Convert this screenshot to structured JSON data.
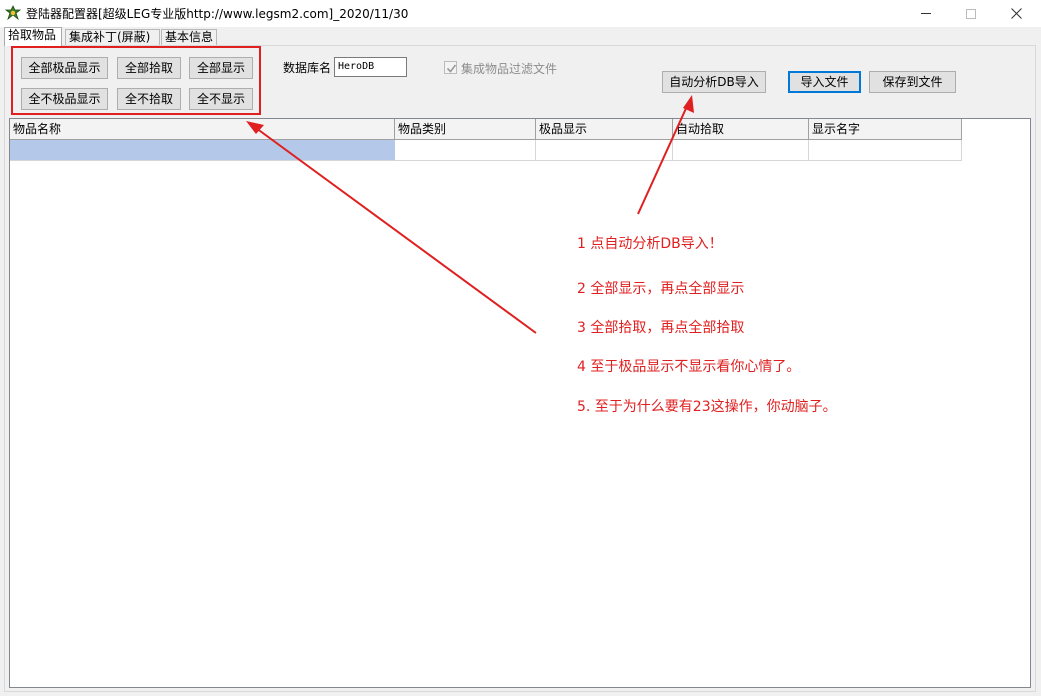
{
  "window": {
    "title": "登陆器配置器[超级LEG专业版http://www.legsm2.com]_2020/11/30",
    "minimize_glyph": "—",
    "maximize_glyph": "☐",
    "close_glyph": "✕"
  },
  "tabs": [
    {
      "label": "拾取物品",
      "active": true
    },
    {
      "label": "集成补丁(屏蔽)",
      "active": false
    },
    {
      "label": "基本信息",
      "active": false
    }
  ],
  "buttons": {
    "all_jipin_show": "全部极品显示",
    "all_pickup": "全部拾取",
    "all_show": "全部显示",
    "none_jipin_show": "全不极品显示",
    "none_pickup": "全不拾取",
    "none_show": "全不显示",
    "auto_import_db": "自动分析DB导入",
    "import_file": "导入文件",
    "save_to_file": "保存到文件"
  },
  "database": {
    "label": "数据库名",
    "value": "HeroDB"
  },
  "filter_checkbox": {
    "label": "集成物品过滤文件",
    "checked": true,
    "enabled": false
  },
  "grid": {
    "columns": [
      "物品名称",
      "物品类别",
      "极品显示",
      "自动拾取",
      "显示名字"
    ],
    "rows": [
      [
        "",
        "",
        "",
        "",
        ""
      ]
    ]
  },
  "annotations": [
    "1 点自动分析DB导入！",
    "2 全部显示，再点全部显示",
    "3 全部拾取，再点全部拾取",
    "4 至于极品显示不显示看你心情了。",
    "5. 至于为什么要有23这操作，你动脑子。"
  ],
  "colors": {
    "annotation_red": "#e02020",
    "selection_blue": "#b4c8ea",
    "default_button_border": "#0078d7"
  }
}
